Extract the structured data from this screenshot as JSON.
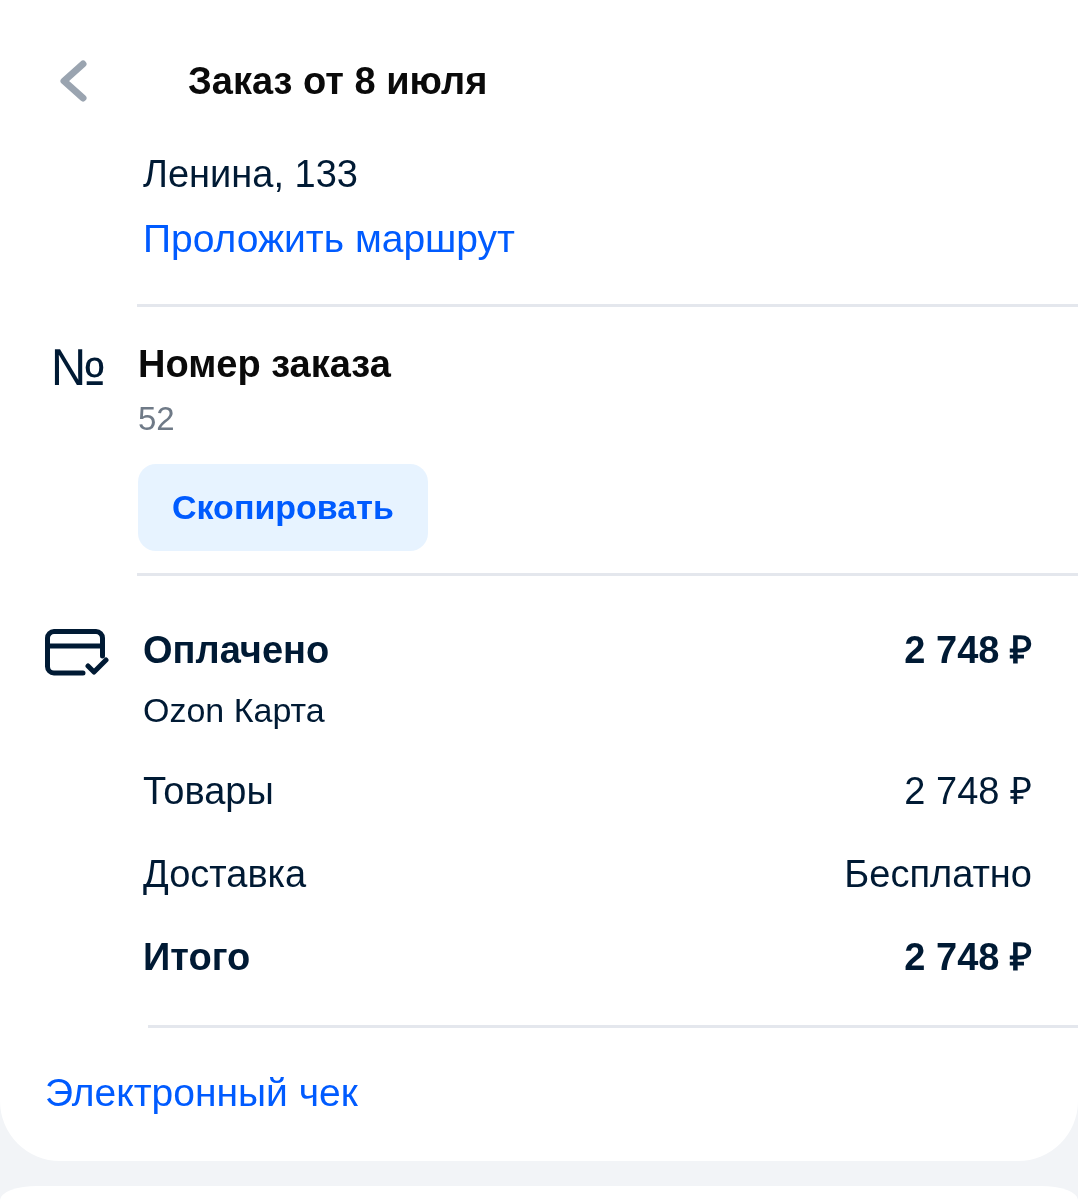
{
  "header": {
    "title": "Заказ от 8 июля"
  },
  "address": {
    "street": "Ленина, 133",
    "route_link": "Проложить маршрут"
  },
  "order_number": {
    "icon": "№",
    "label": "Номер заказа",
    "value": "52",
    "copy_button": "Скопировать"
  },
  "payment": {
    "status": "Оплачено",
    "amount": "2 748 ₽",
    "method": "Ozon Карта",
    "lines": [
      {
        "kind": "regular",
        "label": "Товары",
        "value": "2 748 ₽"
      },
      {
        "kind": "regular",
        "label": "Доставка",
        "value": "Бесплатно"
      },
      {
        "kind": "total",
        "label": "Итого",
        "value": "2 748 ₽"
      }
    ]
  },
  "receipt_link": "Электронный чек"
}
